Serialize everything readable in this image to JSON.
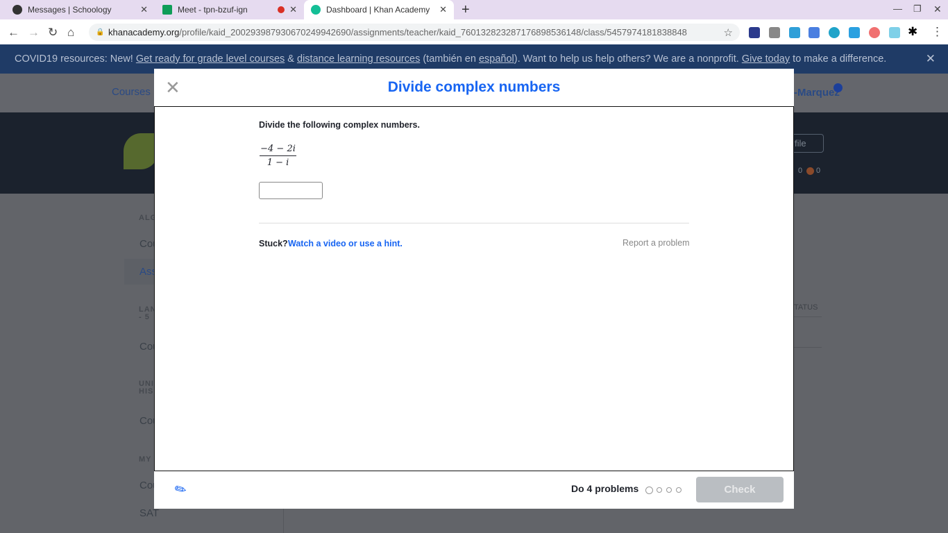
{
  "browser": {
    "tabs": [
      {
        "title": "Messages | Schoology",
        "favicon": "#333"
      },
      {
        "title": "Meet - tpn-bzuf-ign",
        "favicon": "#0f9d58"
      },
      {
        "title": "Dashboard | Khan Academy",
        "favicon": "#14bf96"
      }
    ],
    "url_domain": "khanacademy.org",
    "url_path": "/profile/kaid_200293987930670249942690/assignments/teacher/kaid_760132823287176898536148/class/5457974181838848"
  },
  "banner": {
    "prefix": "COVID19 resources: New! ",
    "link1": "Get ready for grade level courses",
    "amp": " & ",
    "link2": "distance learning resources",
    "mid1": " (también en ",
    "link3": "español",
    "mid2": "). Want to help us help others? We are a nonprofit. ",
    "link4": "Give today",
    "suffix": " to make a difference."
  },
  "background": {
    "courses": "Courses",
    "user": "-Marquez",
    "profile_btn": "file",
    "stats": [
      "0",
      "0"
    ],
    "status_header": "TATUS",
    "sidebar": [
      {
        "label": "ALG",
        "items": [
          "Cou",
          "Ass"
        ]
      },
      {
        "label": "LAN\n- 5",
        "items": [
          "Cou"
        ]
      },
      {
        "label": "UNI\nHIS",
        "items": [
          "Cou"
        ]
      },
      {
        "label": "MY",
        "items": [
          "Cou",
          "SAT"
        ]
      }
    ]
  },
  "modal": {
    "title": "Divide complex numbers",
    "prompt": "Divide the following complex numbers.",
    "numerator": "−4 − 2i",
    "denominator": "1 − i",
    "answer": "",
    "stuck": "Stuck?",
    "hint_link": "Watch a video or use a hint.",
    "report": "Report a problem",
    "do_problems": "Do 4 problems",
    "check": "Check",
    "progress_done": 0,
    "progress_total": 4
  }
}
